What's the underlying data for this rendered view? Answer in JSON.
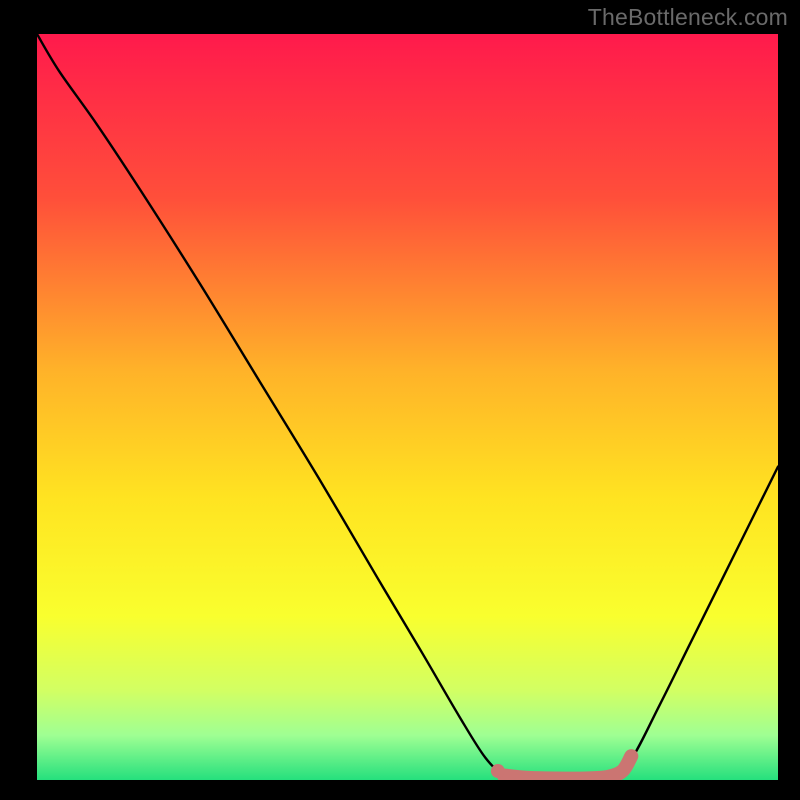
{
  "attribution": "TheBottleneck.com",
  "chart_data": {
    "type": "line",
    "title": "",
    "xlabel": "",
    "ylabel": "",
    "xlim": [
      0,
      100
    ],
    "ylim": [
      0,
      100
    ],
    "gradient_stops": [
      {
        "offset": 0.0,
        "color": "#ff1a4c"
      },
      {
        "offset": 0.22,
        "color": "#ff4f3a"
      },
      {
        "offset": 0.45,
        "color": "#ffb229"
      },
      {
        "offset": 0.62,
        "color": "#ffe321"
      },
      {
        "offset": 0.78,
        "color": "#f9ff2e"
      },
      {
        "offset": 0.88,
        "color": "#d2ff63"
      },
      {
        "offset": 0.94,
        "color": "#9fff93"
      },
      {
        "offset": 1.0,
        "color": "#25e07d"
      }
    ],
    "series": [
      {
        "name": "bottleneck-curve",
        "color": "#000000",
        "x": [
          0.0,
          3.0,
          8.0,
          14.0,
          22.0,
          30.0,
          38.0,
          46.0,
          52.0,
          57.0,
          60.5,
          63.0,
          66.0,
          70.0,
          74.0,
          77.0,
          80.0,
          84.0,
          88.0,
          92.0,
          96.0,
          100.0
        ],
        "values": [
          100.0,
          95.0,
          88.0,
          79.0,
          66.5,
          53.5,
          40.5,
          27.0,
          17.0,
          8.5,
          3.0,
          0.8,
          0.4,
          0.3,
          0.3,
          0.6,
          2.5,
          10.0,
          18.0,
          26.0,
          34.0,
          42.0
        ]
      },
      {
        "name": "sweet-spot-band",
        "color": "#cb7572",
        "x": [
          63.0,
          66.0,
          70.0,
          74.0,
          77.0,
          79.0,
          80.2
        ],
        "values": [
          0.6,
          0.3,
          0.2,
          0.2,
          0.4,
          1.2,
          3.2
        ]
      }
    ],
    "sweet_spot_marker": {
      "x": 62.2,
      "y": 1.2,
      "color": "#cb7572"
    }
  }
}
